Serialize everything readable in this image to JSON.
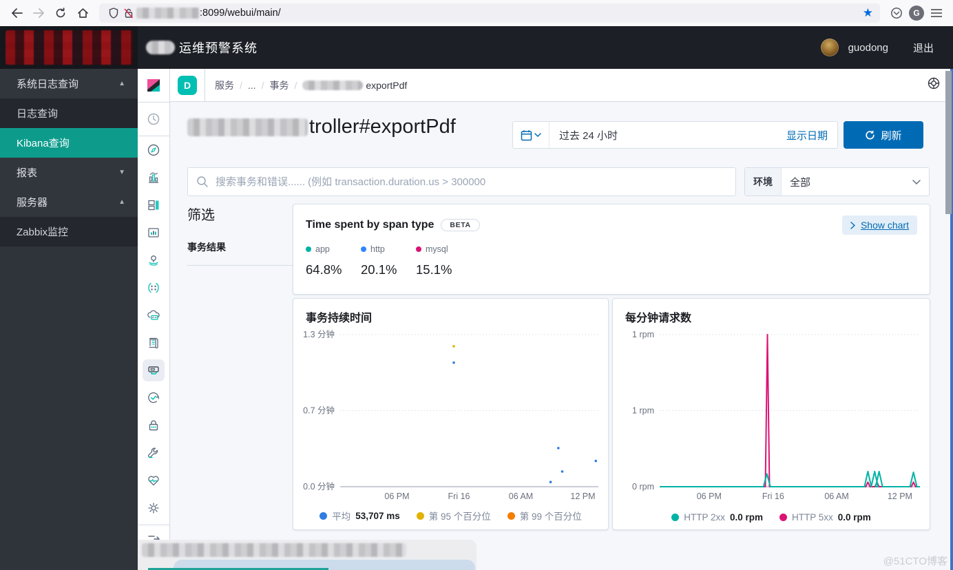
{
  "browser": {
    "url": ":8099/webui/main/",
    "icons": [
      "back-arrow-icon",
      "forward-arrow-icon",
      "reload-icon",
      "home-icon",
      "shield-icon",
      "broken-lock-icon",
      "bookmark-star-icon",
      "pocket-icon",
      "account-avatar",
      "menu-hamburger-icon"
    ]
  },
  "app_header": {
    "title": "运维预警系统",
    "user": "guodong",
    "logout": "退出"
  },
  "sidebar": {
    "items": [
      {
        "label": "系统日志查询",
        "arrow": "▲",
        "type": "section"
      },
      {
        "label": "日志查询",
        "arrow": "",
        "type": "sub"
      },
      {
        "label": "Kibana查询",
        "arrow": "",
        "type": "sub-active"
      },
      {
        "label": "报表",
        "arrow": "▼",
        "type": "section"
      },
      {
        "label": "服务器",
        "arrow": "▲",
        "type": "section"
      },
      {
        "label": "Zabbix监控",
        "arrow": "",
        "type": "sub"
      }
    ]
  },
  "kibana_rail_icons": [
    "kibana-logo",
    "recently-viewed-clock-icon",
    "discover-compass-icon",
    "visualize-chart-icon",
    "dashboard-icon",
    "canvas-icon",
    "maps-pin-icon",
    "machine-learning-icon",
    "infrastructure-cloud-icon",
    "logs-icon",
    "apm-icon",
    "uptime-check-icon",
    "siem-lock-icon",
    "dev-tools-wrench-icon",
    "monitoring-heart-icon",
    "management-gear-icon",
    "collapse-nav-icon"
  ],
  "kibana": {
    "space_initial": "D",
    "breadcrumb": {
      "items": [
        "服务",
        "...",
        "事务"
      ],
      "current": "exportPdf"
    },
    "page_title_visible": "troller#exportPdf",
    "timepicker": {
      "range": "过去 24 小时",
      "show_dates": "显示日期",
      "refresh_label": "刷新"
    },
    "search_placeholder": "搜索事务和错误...... (例如 transaction.duration.us > 300000",
    "env": {
      "label": "环境",
      "value": "全部"
    },
    "filter": {
      "heading": "筛选",
      "section": "事务结果"
    },
    "span_panel": {
      "title": "Time spent by span type",
      "beta": "BETA",
      "show_chart": "Show chart",
      "legend": [
        {
          "label": "app",
          "color": "#00b3a4",
          "value": "64.8%"
        },
        {
          "label": "http",
          "color": "#3185fc",
          "value": "20.1%"
        },
        {
          "label": "mysql",
          "color": "#db1374",
          "value": "15.1%"
        }
      ]
    }
  },
  "chart_data": [
    {
      "type": "scatter",
      "title": "事务持续时间",
      "ylabel_unit": "分钟",
      "ylim": [
        0,
        1.3
      ],
      "grid": "horizontal-dotted",
      "y_ticks": [
        {
          "label": "1.3 分钟",
          "frac": 0
        },
        {
          "label": "0.7 分钟",
          "frac": 0.5
        },
        {
          "label": "0.0 分钟",
          "frac": 1
        }
      ],
      "x_ticks": [
        {
          "label": "06 PM",
          "frac": 0.22
        },
        {
          "label": "Fri 16",
          "frac": 0.46
        },
        {
          "label": "06 AM",
          "frac": 0.7
        },
        {
          "label": "12 PM",
          "frac": 0.94
        }
      ],
      "series_colors": {
        "avg": "#2f7de1",
        "p95": "#e3b201",
        "p99": "#f57d00"
      },
      "points": [
        {
          "series": "p95",
          "x": 0.44,
          "y": 1.2
        },
        {
          "series": "avg",
          "x": 0.44,
          "y": 1.06
        },
        {
          "series": "avg",
          "x": 0.845,
          "y": 0.33
        },
        {
          "series": "avg",
          "x": 0.86,
          "y": 0.13
        },
        {
          "series": "avg",
          "x": 0.99,
          "y": 0.22
        },
        {
          "series": "avg",
          "x": 0.815,
          "y": 0.04
        }
      ],
      "legend": [
        {
          "color": "#2f7de1",
          "label": "平均",
          "value": "53,707 ms"
        },
        {
          "color": "#e3b201",
          "label": "第 95 个百分位",
          "value": ""
        },
        {
          "color": "#f57d00",
          "label": "第 99 个百分位",
          "value": ""
        }
      ],
      "legend_position": "bottom-center"
    },
    {
      "type": "line",
      "title": "每分钟请求数",
      "ylabel_unit": "rpm",
      "ylim": [
        0,
        1
      ],
      "grid": "horizontal-dotted",
      "y_ticks": [
        {
          "label": "1 rpm",
          "frac": 0
        },
        {
          "label": "1 rpm",
          "frac": 0.5
        },
        {
          "label": "0 rpm",
          "frac": 1
        }
      ],
      "x_ticks": [
        {
          "label": "06 PM",
          "frac": 0.19
        },
        {
          "label": "Fri 16",
          "frac": 0.436
        },
        {
          "label": "06 AM",
          "frac": 0.68
        },
        {
          "label": "12 PM",
          "frac": 0.923
        }
      ],
      "series": [
        {
          "name": "HTTP 5xx",
          "color": "#db1374",
          "baseline": 0,
          "spikes": [
            {
              "x": 0.414,
              "h": 1.0,
              "w": 3
            },
            {
              "x": 0.8,
              "h": 0.03,
              "w": 3
            },
            {
              "x": 0.835,
              "h": 0.03,
              "w": 3
            },
            {
              "x": 0.975,
              "h": 0.03,
              "w": 3
            }
          ]
        },
        {
          "name": "HTTP 2xx",
          "color": "#00b3a4",
          "baseline": 0,
          "spikes": [
            {
              "x": 0.412,
              "h": 0.085,
              "w": 5
            },
            {
              "x": 0.8,
              "h": 0.1,
              "w": 5
            },
            {
              "x": 0.826,
              "h": 0.1,
              "w": 5
            },
            {
              "x": 0.843,
              "h": 0.1,
              "w": 5
            },
            {
              "x": 0.975,
              "h": 0.095,
              "w": 5
            }
          ]
        }
      ],
      "legend": [
        {
          "color": "#00b3a4",
          "label": "HTTP 2xx",
          "value": "0.0 rpm"
        },
        {
          "color": "#db1374",
          "label": "HTTP 5xx",
          "value": "0.0 rpm"
        }
      ],
      "legend_position": "bottom-center"
    }
  ],
  "watermark": "@51CTO博客"
}
